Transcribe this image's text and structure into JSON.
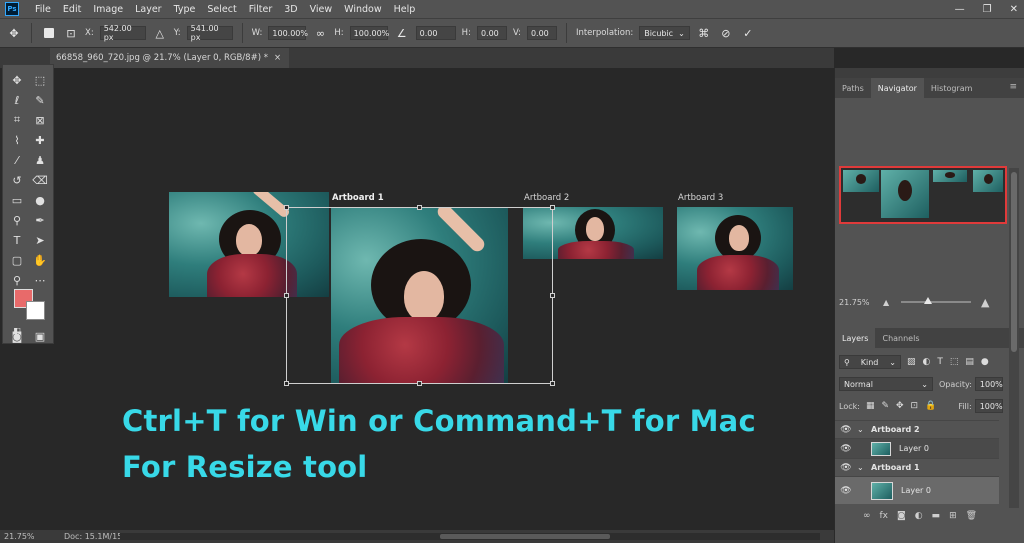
{
  "menu": {
    "logo": "Ps",
    "items": [
      "File",
      "Edit",
      "Image",
      "Layer",
      "Type",
      "Select",
      "Filter",
      "3D",
      "View",
      "Window",
      "Help"
    ]
  },
  "options": {
    "x_label": "X:",
    "x_value": "542.00 px",
    "y_label": "Y:",
    "y_value": "541.00 px",
    "w_label": "W:",
    "w_value": "100.00%",
    "h_label": "H:",
    "h_value": "100.00%",
    "angle_value": "0.00",
    "hskew_label": "H:",
    "hskew_value": "0.00",
    "vskew_label": "V:",
    "vskew_value": "0.00",
    "interp_label": "Interpolation:",
    "interp_value": "Bicubic"
  },
  "doc_tab": {
    "title": "66858_960_720.jpg @ 21.7% (Layer 0, RGB/8#) *",
    "close": "×"
  },
  "canvas": {
    "artboards": [
      "Artboard 1",
      "Artboard 2",
      "Artboard 3"
    ],
    "caption_line1": "Ctrl+T for Win or Command+T for Mac",
    "caption_line2": "For Resize tool"
  },
  "status": {
    "zoom": "21.75%",
    "doc": "Doc: 15.1M/15.8M"
  },
  "panels": {
    "top_tabs": [
      "Paths",
      "Navigator",
      "Histogram"
    ],
    "top_active": 1,
    "nav_zoom": "21.75%",
    "layer_tabs": [
      "Layers",
      "Channels"
    ],
    "kind_label": "Kind",
    "blend_mode": "Normal",
    "opacity_label": "Opacity:",
    "opacity_value": "100%",
    "lock_label": "Lock:",
    "fill_label": "Fill:",
    "fill_value": "100%",
    "layers": [
      {
        "name": "Artboard 2",
        "type": "group"
      },
      {
        "name": "Layer 0",
        "type": "layer"
      },
      {
        "name": "Artboard 1",
        "type": "group"
      },
      {
        "name": "Layer 0",
        "type": "layer",
        "selected": true
      }
    ]
  },
  "colors": {
    "foreground": "#e86a6a",
    "background": "#ffffff",
    "caption": "#38d9e8",
    "nav_highlight": "#e03a3a"
  }
}
